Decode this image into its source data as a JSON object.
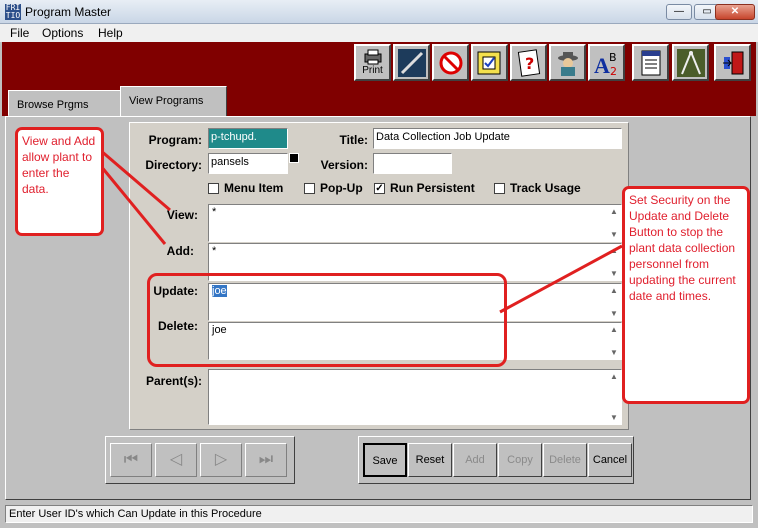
{
  "window": {
    "title": "Program Master",
    "icon_text": "FRI TIO"
  },
  "menu": {
    "file": "File",
    "options": "Options",
    "help": "Help"
  },
  "toolbar": {
    "print_label": "Print"
  },
  "tabs": {
    "browse": "Browse Prgms",
    "view": "View Programs"
  },
  "form": {
    "program_label": "Program:",
    "program_value": "p-tchupd.",
    "title_label": "Title:",
    "title_value": "Data Collection Job Update",
    "directory_label": "Directory:",
    "directory_value": "pansels",
    "version_label": "Version:",
    "version_value": "",
    "menu_item": {
      "label": "Menu Item",
      "checked": false
    },
    "popup": {
      "label": "Pop-Up",
      "checked": false
    },
    "run_persistent": {
      "label": "Run Persistent",
      "checked": true
    },
    "track_usage": {
      "label": "Track Usage",
      "checked": false
    },
    "view_label": "View:",
    "view_value": "*",
    "add_label": "Add:",
    "add_value": "*",
    "update_label": "Update:",
    "update_value": "joe",
    "delete_label": "Delete:",
    "delete_value": "joe",
    "parents_label": "Parent(s):",
    "parents_value": ""
  },
  "nav": {
    "first": "⏮",
    "prev": "◁",
    "next": "▷",
    "last": "⏭"
  },
  "actions": {
    "save": "Save",
    "reset": "Reset",
    "add": "Add",
    "copy": "Copy",
    "delete": "Delete",
    "cancel": "Cancel"
  },
  "status": "Enter User ID's which Can Update in this Procedure",
  "annotations": {
    "left": "View and Add allow plant to enter the data.",
    "right": "Set Security on the Update and Delete Button to stop the plant data collection personnel from updating the current date and times."
  },
  "colors": {
    "maroon": "#800000",
    "annotation_red": "#e02020",
    "program_field": "#1f8a8a"
  }
}
